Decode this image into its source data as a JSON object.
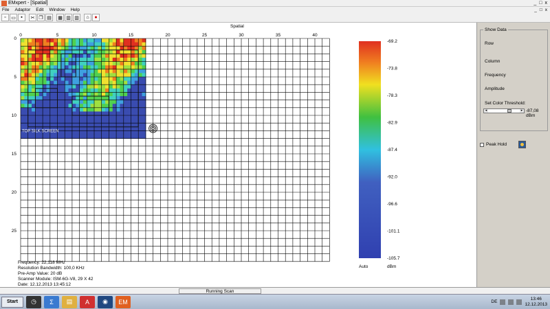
{
  "window": {
    "title": "EMxpert - [Spatial]",
    "controls": [
      "_",
      "□",
      "x"
    ]
  },
  "menu": {
    "items": [
      "File",
      "Adaptor",
      "Edit",
      "Window",
      "Help"
    ],
    "controls": [
      "_",
      "□",
      "x"
    ]
  },
  "plot": {
    "title": "Spatial",
    "x_ticks": [
      "0",
      "5",
      "10",
      "15",
      "20",
      "25",
      "30",
      "35",
      "40"
    ],
    "y_ticks": [
      "0",
      "5",
      "10",
      "15",
      "20",
      "25"
    ],
    "overlay_label": "TOP SILK SCREEN",
    "grid_cols": 42,
    "grid_rows": 29,
    "heatmap_cols": 17,
    "heatmap_rows": 13
  },
  "scale": {
    "labels": [
      "-69.2",
      "-73.8",
      "-78.3",
      "-82.9",
      "-87.4",
      "-92.0",
      "-96.6",
      "-101.1",
      "-105.7"
    ],
    "mode": "Auto",
    "unit": "dBm",
    "colors": [
      "#e03020",
      "#f08020",
      "#f0e020",
      "#40c040",
      "#30c0e0",
      "#4060c0",
      "#3040b0"
    ]
  },
  "panel": {
    "group_title": "Show Data",
    "row": "Row",
    "column": "Column",
    "frequency": "Frequency",
    "amplitude": "Amplitude",
    "threshold_label": "Set Color Threshold:",
    "threshold_value": "-87,08 dBm",
    "peak_hold": "Peak Hold"
  },
  "info": {
    "frequency": "Frequency: 22,118 MHz",
    "rbw": "Resolution Bandwidth: 100,0 KHz",
    "preamp": "Pre-Amp Value: 20 dB",
    "scanner": "Scanner Module: ISM-6G-V8, 29 X 42",
    "date": "Date: 12.12.2013 13:45:12"
  },
  "status": {
    "text": "Running Scan"
  },
  "taskbar": {
    "start": "Start",
    "lang": "DE",
    "time": "13:46",
    "date": "12.12.2013",
    "apps": [
      {
        "name": "clock-app",
        "color": "#333",
        "glyph": "◷"
      },
      {
        "name": "math-app",
        "color": "#3a7ad0",
        "glyph": "Σ"
      },
      {
        "name": "folder-app",
        "color": "#e0b040",
        "glyph": "▤"
      },
      {
        "name": "pdf-app",
        "color": "#d03030",
        "glyph": "A"
      },
      {
        "name": "globe-app",
        "color": "#204880",
        "glyph": "◉"
      },
      {
        "name": "emxpert-app",
        "color": "#e06020",
        "glyph": "EM"
      }
    ]
  }
}
